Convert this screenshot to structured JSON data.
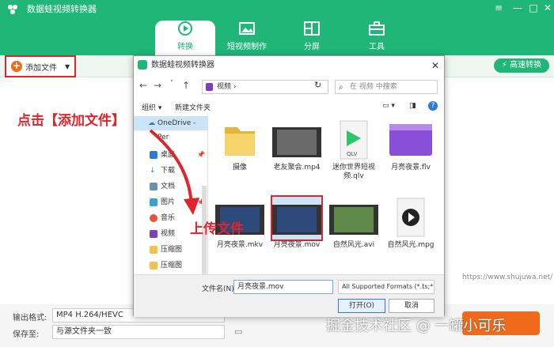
{
  "app": {
    "title": "数据蛙视频转换器",
    "accent": "#1fb678"
  },
  "tabs": [
    {
      "label": "转换",
      "icon": "convert-icon"
    },
    {
      "label": "短视频制作",
      "icon": "image-icon"
    },
    {
      "label": "分屏",
      "icon": "split-screen-icon"
    },
    {
      "label": "工具",
      "icon": "toolbox-icon"
    }
  ],
  "toolbar": {
    "add_file": "添加文件",
    "fast_convert": "高速转换"
  },
  "annotations": {
    "click_hint": "点击【添加文件】",
    "upload_hint": "上传文件"
  },
  "bottom": {
    "format_label": "输出格式:",
    "format_value": "MP4 H.264/HEVC",
    "save_label": "保存至:",
    "save_value": "与源文件夹一致",
    "watermark": "https://www.shujuwa.net/",
    "credit": "掘金技术社区 @ 一罐小可乐"
  },
  "dialog": {
    "title": "数据蛙视频转换器",
    "path": "视频",
    "search_placeholder": "在 视频 中搜索",
    "organize": "组织",
    "new_folder": "新建文件夹",
    "sidebar": [
      {
        "label": "OneDrive - Per",
        "icon": "cloud-icon"
      },
      {
        "label": "桌面",
        "icon": "desktop-icon"
      },
      {
        "label": "下载",
        "icon": "download-icon"
      },
      {
        "label": "文档",
        "icon": "document-icon"
      },
      {
        "label": "图片",
        "icon": "picture-icon"
      },
      {
        "label": "音乐",
        "icon": "music-icon"
      },
      {
        "label": "视频",
        "icon": "video-icon"
      },
      {
        "label": "压缩图",
        "icon": "folder-icon"
      },
      {
        "label": "压缩图",
        "icon": "folder-icon"
      }
    ],
    "files": [
      {
        "name": "摄像",
        "type": "folder"
      },
      {
        "name": "老友聚会.mp4",
        "type": "video"
      },
      {
        "name": "迷你世界短视频.qlv",
        "type": "qlv"
      },
      {
        "name": "月亮夜景.flv",
        "type": "flv"
      },
      {
        "name": "月亮夜景.mkv",
        "type": "video"
      },
      {
        "name": "月亮夜景.mov",
        "type": "video",
        "selected": true
      },
      {
        "name": "自然风光.avi",
        "type": "video"
      },
      {
        "name": "自然风光.mpg",
        "type": "mpg"
      }
    ],
    "filename_label": "文件名(N):",
    "filename_value": "月亮夜景.mov",
    "filetype": "All Supported Formats (*.ts;*",
    "open": "打开(O)",
    "cancel": "取消"
  }
}
